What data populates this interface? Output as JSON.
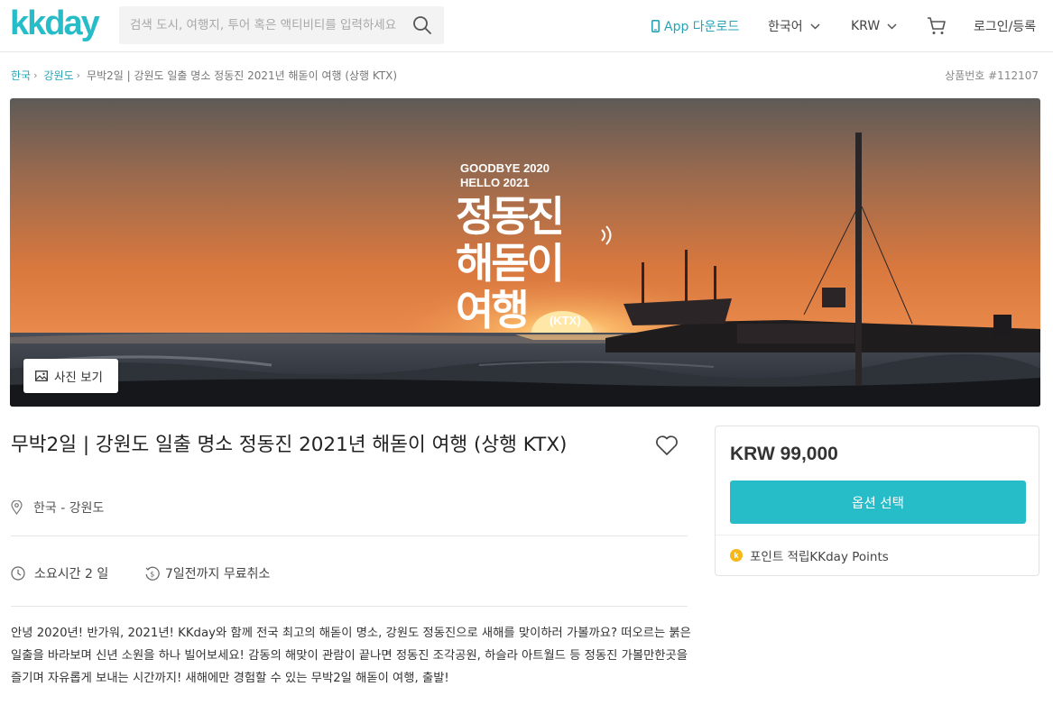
{
  "header": {
    "logo": "kkday",
    "search_placeholder": "검색 도시, 여행지, 투어 혹은 액티비티를 입력하세요",
    "app_download": "App 다운로드",
    "language": "한국어",
    "currency": "KRW",
    "login": "로그인/등록"
  },
  "breadcrumb": {
    "items": [
      "한국",
      "강원도"
    ],
    "current": "무박2일 | 강원도 일출 명소 정동진 2021년 해돋이 여행 (상행 KTX)"
  },
  "product_number": "상품번호 #112107",
  "hero": {
    "line1": "GOODBYE 2020",
    "line2": "HELLO 2021",
    "big1": "정동진",
    "big2": "해돋이",
    "big3": "여행",
    "tag": "(KTX)",
    "photo_button": "사진 보기"
  },
  "product": {
    "title": "무박2일 | 강원도 일출 명소 정동진 2021년 해돋이 여행 (상행 KTX)",
    "location": "한국 - 강원도",
    "duration": "소요시간 2 일",
    "cancellation": "7일전까지 무료취소",
    "description": "안녕 2020년! 반가워, 2021년! KKday와 함께 전국 최고의 해돋이 명소, 강원도 정동진으로 새해를 맞이하러 가볼까요? 떠오르는 붉은 일출을 바라보며 신년 소원을 하나 빌어보세요! 감동의 해맞이 관람이 끝나면 정동진 조각공원, 하슬라 아트월드 등 정동진 가볼만한곳을 즐기며 자유롭게 보내는 시간까지! 새해에만 경험할 수 있는 무박2일 해돋이 여행, 출발!"
  },
  "price_card": {
    "price": "KRW 99,000",
    "button": "옵션 선택",
    "points": "포인트 적립KKday Points",
    "coin": "k"
  },
  "colors": {
    "brand": "#26bdc9",
    "link": "#26a4b6",
    "coin": "#f6b817"
  }
}
